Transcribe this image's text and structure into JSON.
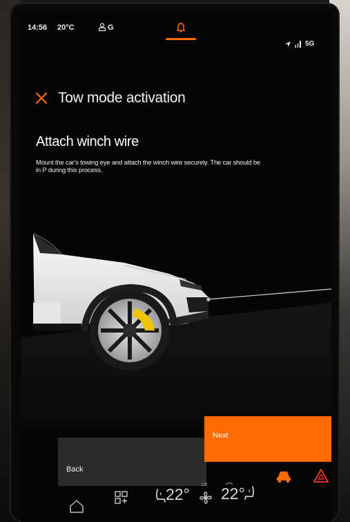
{
  "status_bar": {
    "time": "14:56",
    "temperature": "20°C",
    "user_label": "G",
    "network": "5G"
  },
  "header": {
    "title": "Tow mode activation"
  },
  "step": {
    "title": "Attach winch wire",
    "description": "Mount the car's towing eye and attach the winch wire securely. The car should be in P during this process."
  },
  "buttons": {
    "back_label": "Back",
    "next_label": "Next"
  },
  "climate": {
    "left_temp": "22°",
    "right_temp": "22°",
    "fan_label": "Off"
  },
  "colors": {
    "accent": "#ff6b00",
    "hazard": "#e0322b",
    "background": "#050505"
  },
  "icons": [
    "user-icon",
    "bell-icon",
    "navigation-arrow-icon",
    "signal-icon",
    "close-icon",
    "car-icon",
    "hazard-icon",
    "home-icon",
    "apps-icon",
    "seat-heat-left-icon",
    "fan-icon",
    "airflow-icon",
    "seat-heat-right-icon"
  ]
}
